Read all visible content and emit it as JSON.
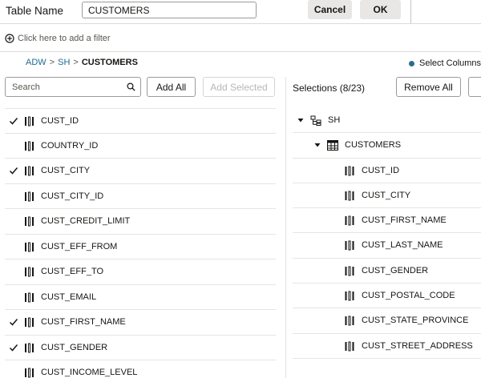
{
  "header": {
    "table_name_label": "Table Name",
    "table_name_value": "CUSTOMERS",
    "cancel_label": "Cancel",
    "ok_label": "OK"
  },
  "filter": {
    "add_filter_label": "Click here to add a filter"
  },
  "breadcrumb": {
    "items": [
      "ADW",
      "SH",
      "CUSTOMERS"
    ],
    "separator": ">"
  },
  "select_columns_label": "Select Columns",
  "left_panel": {
    "search_placeholder": "Search",
    "add_all_label": "Add All",
    "add_selected_label": "Add Selected",
    "columns": [
      {
        "name": "CUST_ID",
        "checked": true
      },
      {
        "name": "COUNTRY_ID",
        "checked": false
      },
      {
        "name": "CUST_CITY",
        "checked": true
      },
      {
        "name": "CUST_CITY_ID",
        "checked": false
      },
      {
        "name": "CUST_CREDIT_LIMIT",
        "checked": false
      },
      {
        "name": "CUST_EFF_FROM",
        "checked": false
      },
      {
        "name": "CUST_EFF_TO",
        "checked": false
      },
      {
        "name": "CUST_EMAIL",
        "checked": false
      },
      {
        "name": "CUST_FIRST_NAME",
        "checked": true
      },
      {
        "name": "CUST_GENDER",
        "checked": true
      },
      {
        "name": "CUST_INCOME_LEVEL",
        "checked": false
      }
    ]
  },
  "right_panel": {
    "title": "Selections (8/23)",
    "remove_all_label": "Remove All",
    "schema": "SH",
    "table": "CUSTOMERS",
    "selected_columns": [
      "CUST_ID",
      "CUST_CITY",
      "CUST_FIRST_NAME",
      "CUST_LAST_NAME",
      "CUST_GENDER",
      "CUST_POSTAL_CODE",
      "CUST_STATE_PROVINCE",
      "CUST_STREET_ADDRESS"
    ]
  },
  "colors": {
    "link": "#1e6b8f",
    "dot": "#2a6d8f",
    "button_grey": "#e8e7e5",
    "border": "#9b9b9b",
    "disabled_text": "#b9b7b4"
  }
}
